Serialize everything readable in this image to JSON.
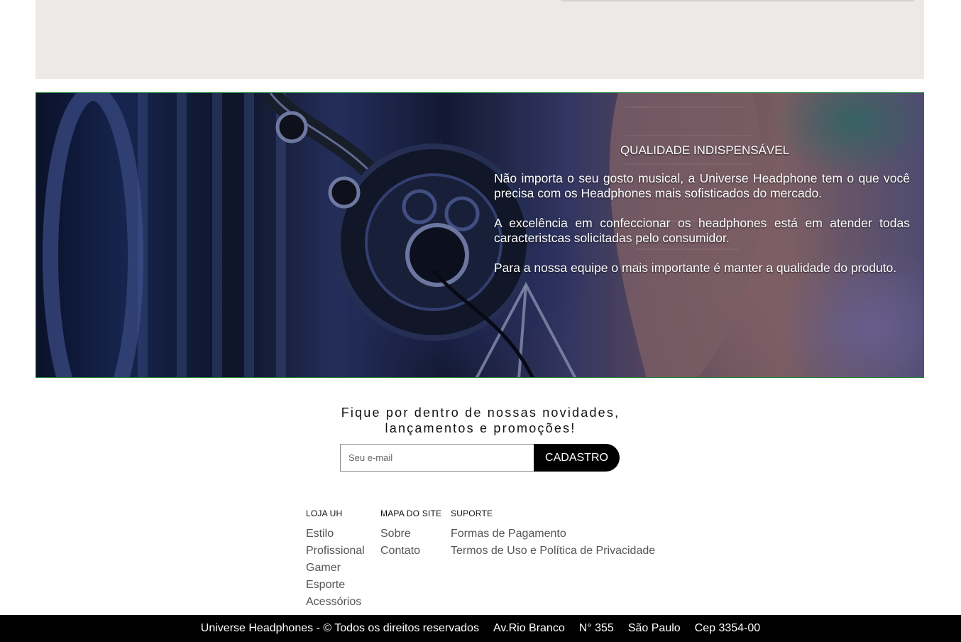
{
  "banner": {
    "title": "QUALIDADE INDISPENSÁVEL",
    "paragraphs": [
      "Não importa o seu gosto musical, a Universe Headphone tem o que você precisa com os Headphones mais sofisticados do mercado.",
      "A excelência em confeccionar os headphones está em atender todas caracteristcas solicitadas pelo consumidor.",
      "Para a nossa equipe o mais importante é manter a qualidade do produto."
    ],
    "image": "headphones-on-microphone-photo"
  },
  "newsletter": {
    "heading_line1": "Fique por dentro de nossas novidades,",
    "heading_line2": "lançamentos e promoções!",
    "email_placeholder": "Seu e-mail",
    "email_value": "",
    "button_label": "CADASTRO"
  },
  "footer": {
    "columns": [
      {
        "title": "LOJA UH",
        "links": [
          "Estilo",
          "Profissional",
          "Gamer",
          "Esporte",
          "Acessórios"
        ]
      },
      {
        "title": "MAPA DO SITE",
        "links": [
          "Sobre",
          "Contato"
        ]
      },
      {
        "title": "SUPORTE",
        "links": [
          "Formas de Pagamento",
          "Termos de Uso e Política de Privacidade"
        ]
      }
    ]
  },
  "bottom_bar": {
    "copyright": "Universe Headphones - © Todos os direitos reservados",
    "street": "Av.Rio Branco",
    "number": "N° 355",
    "city": "São Paulo",
    "zip": "Cep 3354-00"
  },
  "colors": {
    "banner_border": "#1a7a2a",
    "top_panel_bg": "#ede9e6",
    "button_bg": "#000000",
    "bottom_bar_bg": "#000000"
  }
}
